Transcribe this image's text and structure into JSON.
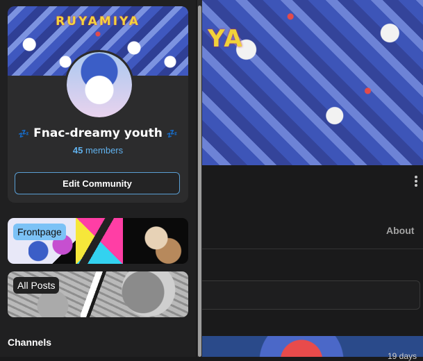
{
  "background": {
    "banner_text": "YA",
    "about_tab": "About",
    "timestamp": "19 days"
  },
  "community": {
    "cover_title": "RUYAMIYA",
    "name_prefix_emoji": "💤",
    "name": "Fnac-dreamy youth",
    "name_suffix_emoji": "💤",
    "member_count": "45",
    "member_label": "members",
    "edit_button": "Edit Community"
  },
  "pages": [
    {
      "label": "Frontpage"
    },
    {
      "label": "All Posts"
    }
  ],
  "channels_heading": "Channels",
  "colors": {
    "drawer_bg": "#202021",
    "card_bg": "#2c2c2d",
    "accent_blue": "#61b2ee",
    "edit_border": "#5a9fd4"
  }
}
